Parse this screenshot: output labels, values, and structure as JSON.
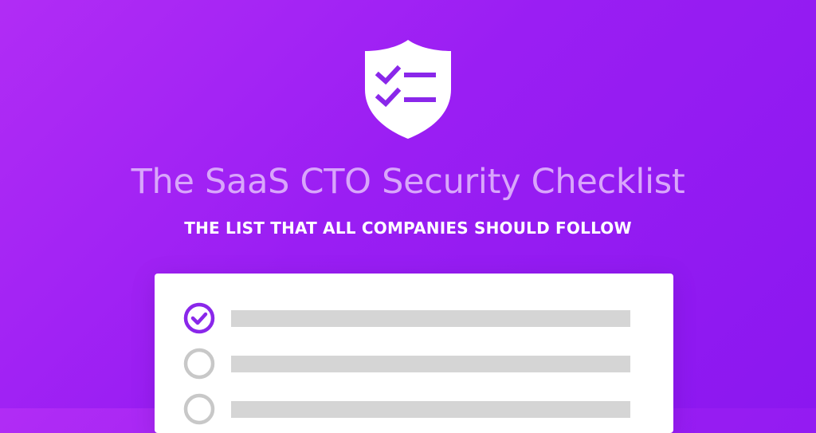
{
  "header": {
    "icon": "shield-checklist-icon",
    "title": "The SaaS CTO Security Checklist",
    "subtitle": "THE LIST THAT ALL COMPANIES SHOULD FOLLOW"
  },
  "colors": {
    "background_start": "#b12cf5",
    "background_end": "#8b17f0",
    "title_color": "#d9a6fb",
    "checked_color": "#8a27ea",
    "unchecked_color": "#c8c8c8",
    "line_color": "#d5d5d5"
  },
  "checklist": {
    "items": [
      {
        "checked": true,
        "icon": "check-circle-icon"
      },
      {
        "checked": false,
        "icon": "empty-circle-icon"
      },
      {
        "checked": false,
        "icon": "empty-circle-icon"
      }
    ]
  }
}
